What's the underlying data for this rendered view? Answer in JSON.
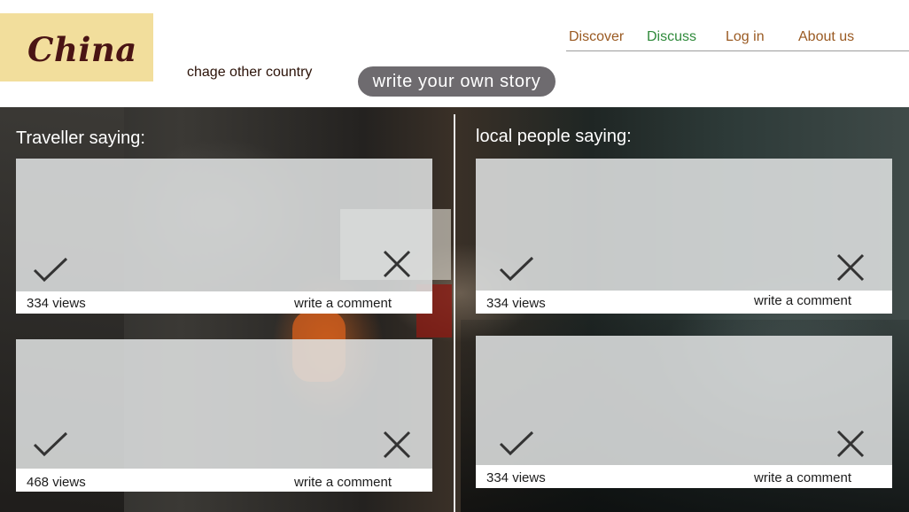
{
  "header": {
    "logo": "China",
    "change_country": "chage other country",
    "story_button": "write your own story",
    "nav": {
      "discover": "Discover",
      "discuss": "Discuss",
      "login": "Log in",
      "about": "About us"
    }
  },
  "colors": {
    "logo_bg": "#f2de9c",
    "logo_text": "#4a1414",
    "nav_text": "#9a5a22",
    "nav_active": "#2f8a3b",
    "story_button_bg": "#6e6b6f"
  },
  "sections": {
    "traveller": {
      "title": "Traveller saying:",
      "cards": [
        {
          "views": "334 views",
          "comment": "write a comment",
          "approve_icon": "check-icon",
          "reject_icon": "close-icon"
        },
        {
          "views": "468 views",
          "comment": "write a comment",
          "approve_icon": "check-icon",
          "reject_icon": "close-icon"
        }
      ]
    },
    "local": {
      "title": "local people saying:",
      "cards": [
        {
          "views": "334 views",
          "comment": "write a comment",
          "approve_icon": "check-icon",
          "reject_icon": "close-icon"
        },
        {
          "views": "334 views",
          "comment": "write a comment",
          "approve_icon": "check-icon",
          "reject_icon": "close-icon"
        }
      ]
    }
  }
}
